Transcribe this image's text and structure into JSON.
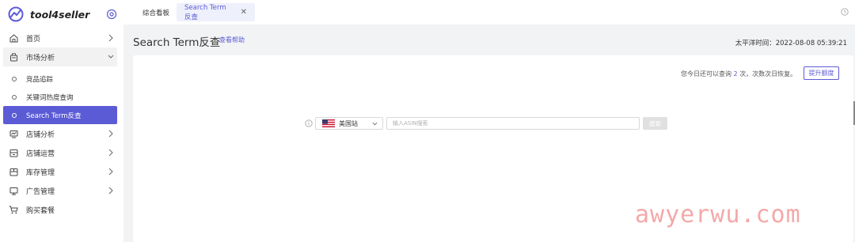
{
  "brand": {
    "name": "tool4seller"
  },
  "sidebar": {
    "items": [
      {
        "label": "首页",
        "icon": "home-icon"
      },
      {
        "label": "市场分析",
        "icon": "bag-icon"
      },
      {
        "label": "店铺分析",
        "icon": "chart-monitor-icon"
      },
      {
        "label": "店铺运营",
        "icon": "store-icon"
      },
      {
        "label": "库存管理",
        "icon": "box-icon"
      },
      {
        "label": "广告管理",
        "icon": "monitor-icon"
      },
      {
        "label": "购买套餐",
        "icon": "cart-icon"
      }
    ],
    "submenu": [
      {
        "label": "竞品追踪"
      },
      {
        "label": "关键词热度查询"
      },
      {
        "label": "Search Term反查"
      }
    ]
  },
  "tabs": [
    {
      "label": "综合看板"
    },
    {
      "label": "Search Term反查"
    }
  ],
  "header": {
    "title": "Search Term反查",
    "help_link": "查看帮助",
    "time_prefix": "太平洋时间：",
    "time_value": "2022-08-08 05:39:21"
  },
  "quota": {
    "before": "您今日还可以查询",
    "count": "2",
    "after": "次，次数次日恢复。",
    "upgrade_label": "提升额度"
  },
  "search": {
    "marketplace": "美国站",
    "placeholder": "输入ASIN搜索",
    "button_label": "搜索"
  },
  "watermark": "awyerwu.com",
  "colors": {
    "accent": "#5b5bd6",
    "watermark": "#f39a9a"
  }
}
